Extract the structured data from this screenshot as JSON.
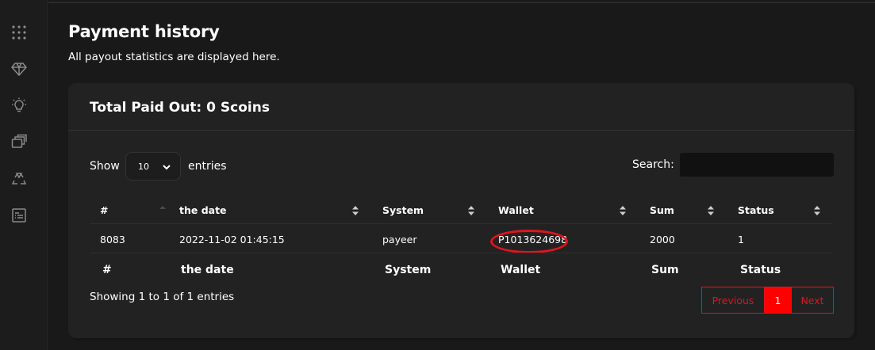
{
  "sidebar": {
    "items": [
      {
        "icon": "grid-icon"
      },
      {
        "icon": "diamond-icon"
      },
      {
        "icon": "lightbulb-icon"
      },
      {
        "icon": "gallery-icon"
      },
      {
        "icon": "recycle-icon"
      },
      {
        "icon": "document-icon"
      }
    ]
  },
  "page": {
    "title": "Payment history",
    "subtitle": "All payout statistics are displayed here."
  },
  "card": {
    "title": "Total Paid Out: 0 Scoins"
  },
  "table_controls": {
    "show_label": "Show",
    "page_length": "10",
    "entries_label": "entries",
    "search_label": "Search:",
    "search_value": ""
  },
  "table": {
    "columns": [
      "#",
      "the date",
      "System",
      "Wallet",
      "Sum",
      "Status"
    ],
    "rows": [
      [
        "8083",
        "2022-11-02 01:45:15",
        "payeer",
        "P1013624698",
        "2000",
        "1"
      ]
    ],
    "footer": [
      "#",
      "the date",
      "System",
      "Wallet",
      "Sum",
      "Status"
    ]
  },
  "pagination": {
    "info": "Showing 1 to 1 of 1 entries",
    "previous": "Previous",
    "current": "1",
    "next": "Next"
  },
  "colors": {
    "accent": "#e0141e",
    "background": "#191919",
    "card": "#222222"
  }
}
